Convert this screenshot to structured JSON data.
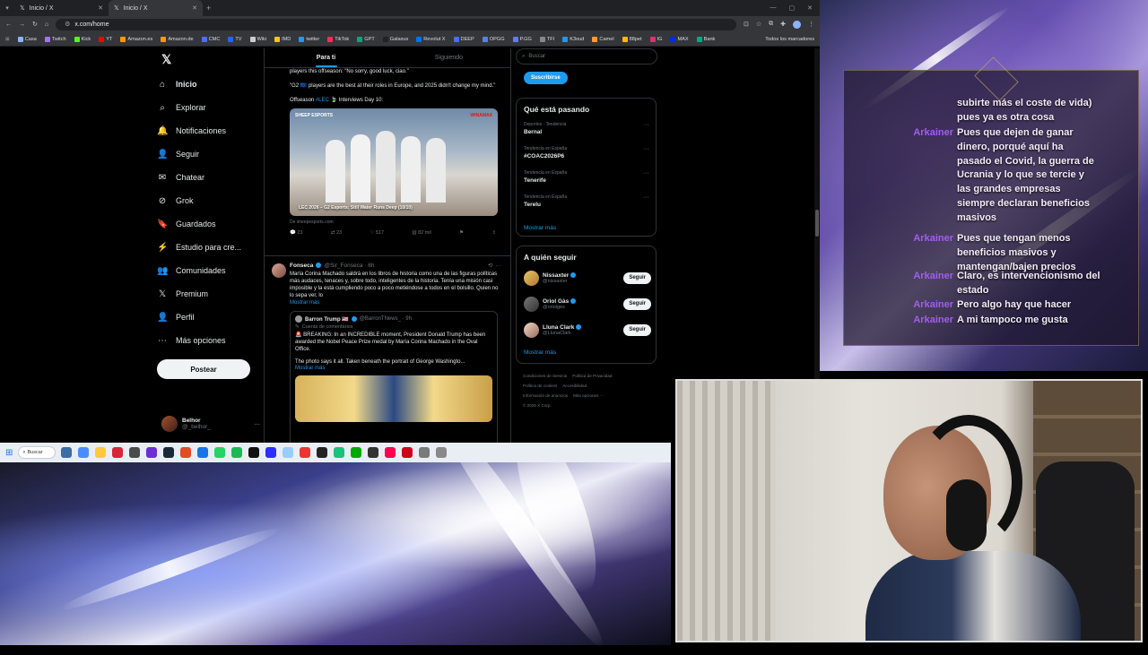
{
  "browser": {
    "tabs": [
      {
        "title": "Inicio / X"
      },
      {
        "title": "Inicio / X"
      }
    ],
    "url": "x.com/home",
    "bookmarks": [
      "Casa",
      "Twitch",
      "Kick",
      "YT",
      "Amazon.es",
      "Amazon.de",
      "CMC",
      "TV",
      "Wiki",
      "IMD",
      "twitter",
      "TikTok",
      "GPT",
      "Galaxus",
      "Revolut X",
      "DEEP",
      "OPGG",
      "P.GG",
      "TFI",
      "K3oud",
      "Camel",
      "88pet",
      "IG",
      "MAX",
      "Bank"
    ],
    "bookmarks_all": "Todos los marcadores"
  },
  "x": {
    "nav": [
      "Inicio",
      "Explorar",
      "Notificaciones",
      "Seguir",
      "Chatear",
      "Grok",
      "Guardados",
      "Estudio para cre...",
      "Comunidades",
      "Premium",
      "Perfil",
      "Más opciones"
    ],
    "post_button": "Postear",
    "user": {
      "name": "Belhor",
      "handle": "@_belhor_"
    },
    "feed_tabs": [
      "Para ti",
      "Siguiendo"
    ],
    "tweet1": {
      "line0": "players this offseason: \"No sorry, good luck, ciao.\"",
      "line1": "\"G2 🇪🇺 players are the best at their roles in Europe, and 2025 didn't change my mind.\"",
      "line2_pre": "Offseason ",
      "line2_tag": "#LEC",
      "line2_post": " 🍃 Interviews Day 10:",
      "media_brand": "SHEEP ESPORTS",
      "media_caption": "LEC 2026 – G2 Esports: Still Water Runs Deep (10/10)",
      "media_corner": "WINAMAX",
      "source": "De sheepesports.com",
      "actions": {
        "replies": "23",
        "reposts": "23",
        "likes": "517",
        "views": "82 mil"
      }
    },
    "tweet2": {
      "name": "Fonseca",
      "handle": "@Sir_Fonseca · 6h",
      "text": "María Corina Machado saldrá en los libros de historia como una de las figuras políticas más audaces, tenaces y, sobre todo, inteligentes de la historia. Tenía una misión casi imposible y la está cumpliendo poco a poco metiéndose a todos en el bolsillo. Quien no lo sepa ver, lo",
      "show_more": "Mostrar más",
      "quote": {
        "name": "Barron Trump 🇺🇸",
        "handle": "@BarronTNews_ · 9h",
        "community": "Cuenta de comentarios",
        "text": "🚨 BREAKING: In an INCREDIBLE moment, President Donald Trump has been awarded the Nobel Peace Prize medal by María Corina Machado in the Oval Office.",
        "text2": "The photo says it all. Taken beneath the portrait of George Washingto...",
        "show_more": "Mostrar más"
      }
    },
    "right": {
      "search_placeholder": "Buscar",
      "subscribe": "Suscribirse",
      "trends_title": "Qué está pasando",
      "trends": [
        {
          "meta": "Deportes · Tendencia",
          "name": "Bernal"
        },
        {
          "meta": "Tendencia en España",
          "name": "#COAC2026P6"
        },
        {
          "meta": "Tendencia en España",
          "name": "Tenerife"
        },
        {
          "meta": "Tendencia en España",
          "name": "Terelu"
        }
      ],
      "trends_more": "Mostrar más",
      "follow_title": "A quién seguir",
      "follow": [
        {
          "name": "Nissaxter",
          "handle": "@nissaxter",
          "btn": "Seguir"
        },
        {
          "name": "Oriol Gàs",
          "handle": "@oriolges",
          "btn": "Seguir"
        },
        {
          "name": "Lluna Clark",
          "handle": "@LlunaClark",
          "btn": "Seguir"
        }
      ],
      "follow_more": "Mostrar más",
      "footer": [
        "Condiciones de Servicio",
        "Política de Privacidad",
        "Política de cookies",
        "Accesibilidad",
        "Información de anuncios",
        "Más opciones ···",
        "© 2026 X Corp."
      ]
    }
  },
  "taskbar": {
    "search": "Buscar"
  },
  "chat": [
    {
      "user": "",
      "msg": "subirte más el coste de vida) pues ya es otra cosa"
    },
    {
      "user": "Arkainer",
      "msg": "Pues que dejen de ganar dinero, porqué aquí ha pasado el Covid, la guerra de Ucrania y lo que se tercie y las grandes empresas siempre declaran beneficios masivos"
    },
    {
      "user": "Arkainer",
      "msg": "Pues que tengan menos beneficios masivos y mantengan/bajen precios"
    },
    {
      "user": "Arkainer",
      "msg": "Claro, es intervencionismo del estado"
    },
    {
      "user": "Arkainer",
      "msg": "Pero algo hay que hacer"
    },
    {
      "user": "Arkainer",
      "msg": "A mi tampoco me gusta"
    }
  ],
  "colors": {
    "accent": "#1d9bf0",
    "chat_user": "#a35cf0"
  }
}
